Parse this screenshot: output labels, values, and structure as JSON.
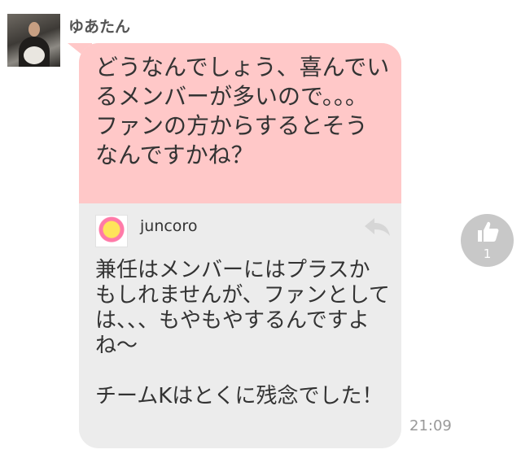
{
  "message": {
    "sender_name": "ゆあたん",
    "text": "どうなんでしょう、喜んでいるメンバーが多いので。。。\nファンの方からするとそうなんですかね？",
    "timestamp": "21:09"
  },
  "quoted_post": {
    "author": "juncoro",
    "text": "兼任はメンバーにはプラスかもしれませんが、ファンとしては、、、もやもやするんですよね〜\n\nチームKはとくに残念でした！"
  },
  "like": {
    "count": "1",
    "icon": "thumbs-up-icon"
  },
  "icons": {
    "reply": "reply-arrow-icon"
  },
  "colors": {
    "message_bubble": "#ffc8c8",
    "quote_area": "#ececec",
    "like_button": "#c8c8c8",
    "timestamp": "#999999"
  }
}
